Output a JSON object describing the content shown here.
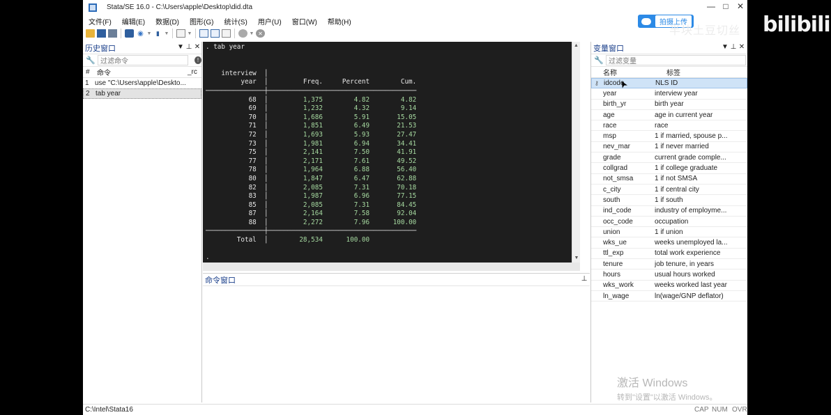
{
  "window": {
    "title": "Stata/SE 16.0 - C:\\Users\\apple\\Desktop\\did.dta",
    "controls": [
      "—",
      "□",
      "✕"
    ]
  },
  "overlay": {
    "upload_label": "拍摄上传",
    "author": "半块土豆切丝",
    "logo": "bilibili",
    "activation_title": "激活 Windows",
    "activation_sub": "转到\"设置\"以激活 Windows。"
  },
  "menu": [
    "文件(F)",
    "编辑(E)",
    "数据(D)",
    "图形(G)",
    "统计(S)",
    "用户(U)",
    "窗口(W)",
    "帮助(H)"
  ],
  "history": {
    "title": "历史窗口",
    "filter_placeholder": "过滤命令",
    "col_num": "#",
    "col_cmd": "命令",
    "col_rc": "_rc",
    "rows": [
      {
        "num": "1",
        "cmd": "use \"C:\\Users\\apple\\Deskto..."
      },
      {
        "num": "2",
        "cmd": "tab year"
      }
    ]
  },
  "results": {
    "command": ". tab year",
    "header": [
      "interview",
      "year",
      "Freq.",
      "Percent",
      "Cum."
    ],
    "rows": [
      [
        "68",
        "1,375",
        "4.82",
        "4.82"
      ],
      [
        "69",
        "1,232",
        "4.32",
        "9.14"
      ],
      [
        "70",
        "1,686",
        "5.91",
        "15.05"
      ],
      [
        "71",
        "1,851",
        "6.49",
        "21.53"
      ],
      [
        "72",
        "1,693",
        "5.93",
        "27.47"
      ],
      [
        "73",
        "1,981",
        "6.94",
        "34.41"
      ],
      [
        "75",
        "2,141",
        "7.50",
        "41.91"
      ],
      [
        "77",
        "2,171",
        "7.61",
        "49.52"
      ],
      [
        "78",
        "1,964",
        "6.88",
        "56.40"
      ],
      [
        "80",
        "1,847",
        "6.47",
        "62.88"
      ],
      [
        "82",
        "2,085",
        "7.31",
        "70.18"
      ],
      [
        "83",
        "1,987",
        "6.96",
        "77.15"
      ],
      [
        "85",
        "2,085",
        "7.31",
        "84.45"
      ],
      [
        "87",
        "2,164",
        "7.58",
        "92.04"
      ],
      [
        "88",
        "2,272",
        "7.96",
        "100.00"
      ]
    ],
    "total": [
      "Total",
      "28,534",
      "100.00"
    ],
    "prompt": "."
  },
  "command_window": {
    "title": "命令窗口"
  },
  "variables": {
    "title": "变量窗口",
    "filter_placeholder": "过滤变量",
    "col_name": "名称",
    "col_label": "标签",
    "rows": [
      {
        "name": "idcode",
        "label": "NLS ID"
      },
      {
        "name": "year",
        "label": "interview year"
      },
      {
        "name": "birth_yr",
        "label": "birth year"
      },
      {
        "name": "age",
        "label": "age in current year"
      },
      {
        "name": "race",
        "label": "race"
      },
      {
        "name": "msp",
        "label": "1 if married, spouse p..."
      },
      {
        "name": "nev_mar",
        "label": "1 if never married"
      },
      {
        "name": "grade",
        "label": "current grade comple..."
      },
      {
        "name": "collgrad",
        "label": "1 if college graduate"
      },
      {
        "name": "not_smsa",
        "label": "1 if not SMSA"
      },
      {
        "name": "c_city",
        "label": "1 if central city"
      },
      {
        "name": "south",
        "label": "1 if south"
      },
      {
        "name": "ind_code",
        "label": "industry of employme..."
      },
      {
        "name": "occ_code",
        "label": "occupation"
      },
      {
        "name": "union",
        "label": "1 if union"
      },
      {
        "name": "wks_ue",
        "label": "weeks unemployed la..."
      },
      {
        "name": "ttl_exp",
        "label": "total work experience"
      },
      {
        "name": "tenure",
        "label": "job tenure, in years"
      },
      {
        "name": "hours",
        "label": "usual hours worked"
      },
      {
        "name": "wks_work",
        "label": "weeks worked last year"
      },
      {
        "name": "ln_wage",
        "label": "ln(wage/GNP deflator)"
      }
    ]
  },
  "status": {
    "path": "C:\\Intel\\Stata16",
    "caps": "CAP",
    "num": "NUM",
    "ovr": "OVR"
  }
}
